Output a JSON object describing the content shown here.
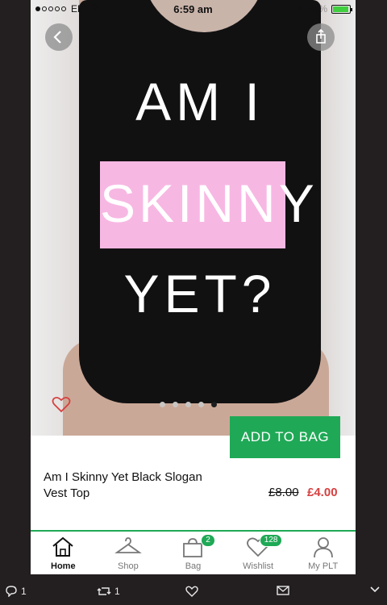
{
  "status_bar": {
    "carrier": "EE",
    "time": "6:59 am",
    "signal_dots": [
      true,
      false,
      false,
      false,
      false
    ],
    "battery_label": "80%"
  },
  "hero": {
    "slogan": [
      "AM I",
      "SKINNY",
      "YET?"
    ],
    "carousel_dots": 5,
    "active_dot": 4
  },
  "actions": {
    "add_to_bag": "ADD TO BAG"
  },
  "product": {
    "title": "Am I Skinny Yet Black Slogan Vest Top",
    "price_old": "£8.00",
    "price_new": "£4.00"
  },
  "tabs": [
    {
      "label": "Home",
      "icon": "home-icon",
      "active": true
    },
    {
      "label": "Shop",
      "icon": "hanger-icon"
    },
    {
      "label": "Bag",
      "icon": "bag-icon",
      "badge": "2"
    },
    {
      "label": "Wishlist",
      "icon": "heart-icon",
      "badge": "128"
    },
    {
      "label": "My PLT",
      "icon": "user-icon"
    }
  ],
  "tweet_actions": {
    "reply_count": "1",
    "retweet_count": "1"
  },
  "colors": {
    "accent_green": "#1fa956",
    "sale_red": "#d64040",
    "slogan_pink": "#f7b7e3"
  }
}
